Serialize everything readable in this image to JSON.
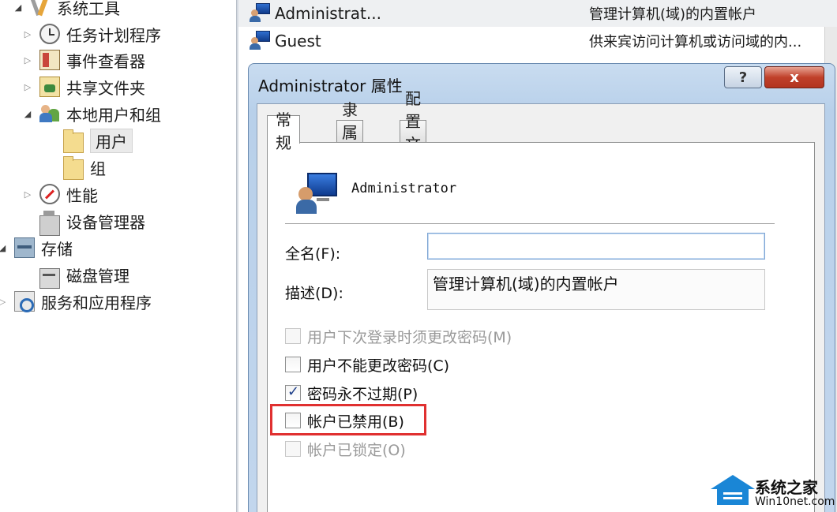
{
  "tree": {
    "items": [
      {
        "label": "系统工具",
        "icon": "tools-icon",
        "expander": "open"
      },
      {
        "label": "任务计划程序",
        "icon": "clock-icon",
        "expander": "closed"
      },
      {
        "label": "事件查看器",
        "icon": "event-viewer-icon",
        "expander": "closed"
      },
      {
        "label": "共享文件夹",
        "icon": "shared-folder-icon",
        "expander": "closed"
      },
      {
        "label": "本地用户和组",
        "icon": "users-group-icon",
        "expander": "open"
      },
      {
        "label": "用户",
        "icon": "folder-icon",
        "expander": "none",
        "selected": true
      },
      {
        "label": "组",
        "icon": "folder-icon",
        "expander": "none"
      },
      {
        "label": "性能",
        "icon": "performance-icon",
        "expander": "closed"
      },
      {
        "label": "设备管理器",
        "icon": "device-manager-icon",
        "expander": "none"
      },
      {
        "label": "存储",
        "icon": "storage-icon",
        "expander": "open"
      },
      {
        "label": "磁盘管理",
        "icon": "disk-icon",
        "expander": "none"
      },
      {
        "label": "服务和应用程序",
        "icon": "services-icon",
        "expander": "closed"
      }
    ]
  },
  "user_list": {
    "rows": [
      {
        "name": "Administrat...",
        "description": "管理计算机(域)的内置帐户"
      },
      {
        "name": "Guest",
        "description": "供来宾访问计算机或访问域的内..."
      }
    ]
  },
  "dialog": {
    "title": "Administrator 属性",
    "help_glyph": "?",
    "close_glyph": "x",
    "tabs": [
      "常规",
      "隶属于",
      "配置文件"
    ],
    "user_name": "Administrator",
    "full_name_label": "全名(F):",
    "full_name_value": "",
    "description_label": "描述(D):",
    "description_value": "管理计算机(域)的内置帐户",
    "checkboxes": [
      {
        "label": "用户下次登录时须更改密码(M)",
        "checked": false,
        "enabled": false
      },
      {
        "label": "用户不能更改密码(C)",
        "checked": false,
        "enabled": true
      },
      {
        "label": "密码永不过期(P)",
        "checked": true,
        "enabled": true
      },
      {
        "label": "帐户已禁用(B)",
        "checked": false,
        "enabled": true,
        "highlighted": true
      },
      {
        "label": "帐户已锁定(O)",
        "checked": false,
        "enabled": false
      }
    ],
    "highlight_color": "#e03030"
  },
  "watermark": {
    "title": "系统之家",
    "url": "Win10net.com"
  }
}
